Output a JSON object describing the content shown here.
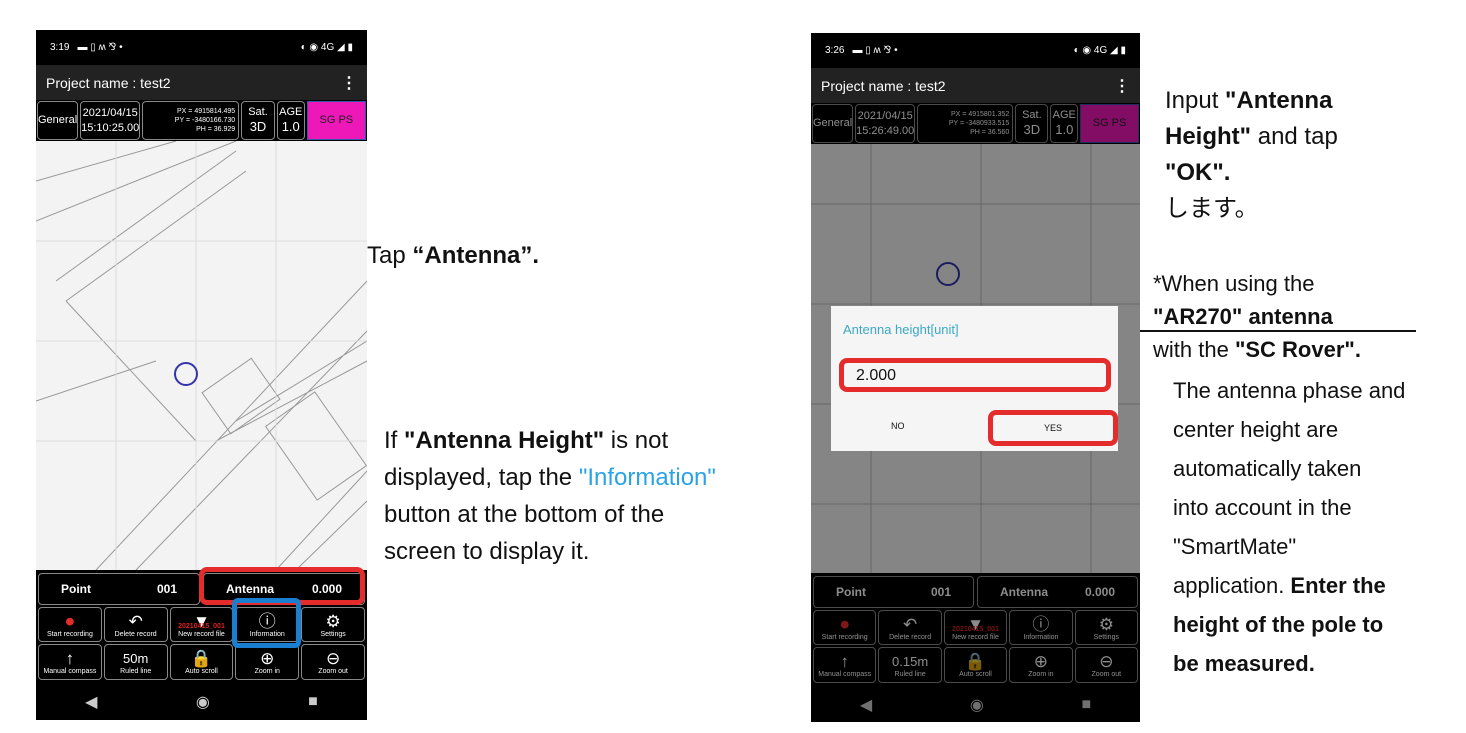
{
  "phones": [
    {
      "time": "3:19",
      "title": "Project name : test2",
      "mode": "General",
      "date": "2021/04/15",
      "clock": "15:10:25.00",
      "px": "PX = 4915814.495",
      "py": "PY = -3480166.730",
      "ph": "PH = 36.929",
      "sat_label": "Sat.",
      "sat": "3D",
      "age_label": "AGE",
      "age": "1.0",
      "sgps": "SG PS",
      "point_label": "Point",
      "point": "001",
      "antenna_label": "Antenna",
      "antenna": "0.000",
      "buttons": [
        {
          "icon": "record-icon",
          "label": "Start recording"
        },
        {
          "icon": "undo-icon",
          "label": "Delete record"
        },
        {
          "icon": "file-icon",
          "label": "New record file",
          "tag": "20210415_001"
        },
        {
          "icon": "info-icon",
          "label": "Information"
        },
        {
          "icon": "gear-icon",
          "label": "Settings"
        },
        {
          "icon": "arrow-up-icon",
          "label": "Manual compass"
        },
        {
          "icon": "",
          "label": "Ruled line",
          "value": "50m"
        },
        {
          "icon": "lock-icon",
          "label": "Auto scroll"
        },
        {
          "icon": "zoom-in-icon",
          "label": "Zoom in"
        },
        {
          "icon": "zoom-out-icon",
          "label": "Zoom out"
        }
      ]
    },
    {
      "time": "3:26",
      "title": "Project name : test2",
      "mode": "General",
      "date": "2021/04/15",
      "clock": "15:26:49.00",
      "px": "PX = 4915801.352",
      "py": "PY = -3480933.515",
      "ph": "PH = 36.560",
      "sat_label": "Sat.",
      "sat": "3D",
      "age_label": "AGE",
      "age": "1.0",
      "sgps": "SG PS",
      "point_label": "Point",
      "point": "001",
      "antenna_label": "Antenna",
      "antenna": "0.000",
      "buttons": [
        {
          "icon": "record-icon",
          "label": "Start recording"
        },
        {
          "icon": "undo-icon",
          "label": "Delete record"
        },
        {
          "icon": "file-icon",
          "label": "New record file",
          "tag": "20210415_001"
        },
        {
          "icon": "info-icon",
          "label": "Information"
        },
        {
          "icon": "gear-icon",
          "label": "Settings"
        },
        {
          "icon": "arrow-up-icon",
          "label": "Manual compass"
        },
        {
          "icon": "",
          "label": "Ruled line",
          "value": "0.15m"
        },
        {
          "icon": "lock-icon",
          "label": "Auto scroll"
        },
        {
          "icon": "zoom-in-icon",
          "label": "Zoom in"
        },
        {
          "icon": "zoom-out-icon",
          "label": "Zoom out"
        }
      ]
    }
  ],
  "dialog": {
    "title": "Antenna height[unit]",
    "value": "2.000",
    "no": "NO",
    "yes": "YES"
  },
  "notes": {
    "tap_pre": "Tap ",
    "tap_bold": "“Antenna”.",
    "if_1": "If ",
    "if_2": "\"Antenna Height\"",
    "if_3": " is not",
    "if_4": "displayed, tap the ",
    "if_5": "\"Information\"",
    "if_6": "button at the bottom of the",
    "if_7": "screen to display it.",
    "input_1": "Input ",
    "input_2": "\"Antenna",
    "input_3": "Height\"",
    "input_4": " and tap",
    "input_5": "\"OK\".",
    "input_6": "します。",
    "when_1": "*When using the",
    "when_2": "\"AR270\" antenna",
    "when_3": "with the ",
    "when_4": "\"SC Rover\".",
    "auto_1": "The antenna phase and",
    "auto_2": "center height are",
    "auto_3": "automatically taken",
    "auto_4": "into account in the",
    "auto_5": "\"SmartMate\"",
    "auto_6": "application. ",
    "auto_7": "Enter the",
    "auto_8": "height of the pole to",
    "auto_9": "be measured."
  }
}
